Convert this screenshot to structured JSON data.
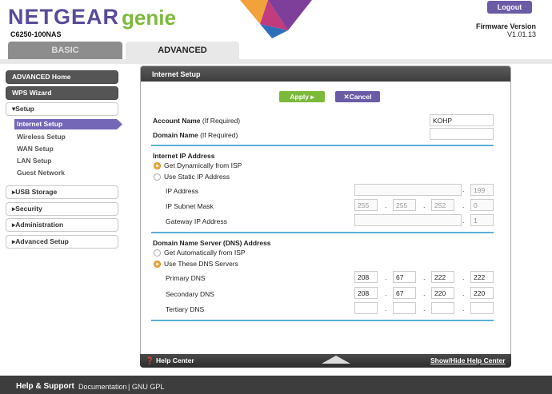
{
  "header": {
    "brand": "NETGEAR",
    "product": "genie",
    "model": "C6250-100NAS",
    "logout": "Logout",
    "firmware_label": "Firmware Version",
    "firmware_version": "V1.01.13"
  },
  "tabs": {
    "basic": "BASIC",
    "advanced": "ADVANCED"
  },
  "sidebar": {
    "advanced_home": "ADVANCED Home",
    "wps_wizard": "WPS Wizard",
    "setup": "▾Setup",
    "sub": [
      "Internet Setup",
      "Wireless Setup",
      "WAN Setup",
      "LAN Setup",
      "Guest Network"
    ],
    "usb_storage": "▸USB Storage",
    "security": "▸Security",
    "administration": "▸Administration",
    "advanced_setup": "▸Advanced Setup"
  },
  "panel": {
    "title": "Internet Setup",
    "apply": "Apply ▸",
    "cancel": "✕Cancel",
    "account_name_label": "Account Name",
    "account_name_hint": "(If Required)",
    "account_name_value": "KOHP",
    "domain_name_label": "Domain Name",
    "domain_name_hint": "(If Required)",
    "domain_name_value": "",
    "ip_section": "Internet IP Address",
    "ip_opt1": "Get Dynamically from ISP",
    "ip_opt2": "Use Static IP Address",
    "ip_address_label": "IP Address",
    "ip_address": [
      "",
      "",
      "",
      "199"
    ],
    "subnet_label": "IP Subnet Mask",
    "subnet": [
      "255",
      "255",
      "252",
      "0"
    ],
    "gateway_label": "Gateway IP Address",
    "gateway": [
      "",
      "",
      "",
      "1"
    ],
    "dns_section": "Domain Name Server (DNS) Address",
    "dns_opt1": "Get Automatically from ISP",
    "dns_opt2": "Use These DNS Servers",
    "primary_label": "Primary DNS",
    "primary": [
      "208",
      "67",
      "222",
      "222"
    ],
    "secondary_label": "Secondary DNS",
    "secondary": [
      "208",
      "67",
      "220",
      "220"
    ],
    "tertiary_label": "Tertiary DNS",
    "tertiary": [
      "",
      "",
      "",
      ""
    ]
  },
  "help": {
    "center": "Help Center",
    "toggle": "Show/Hide Help Center"
  },
  "footer": {
    "title": "Help & Support",
    "documentation": "Documentation",
    "gnu": "| GNU GPL"
  }
}
